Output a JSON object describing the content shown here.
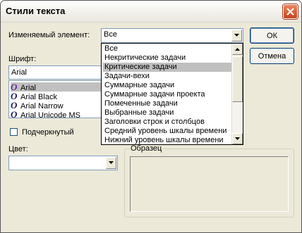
{
  "window": {
    "title": "Стили текста"
  },
  "element_label": "Изменяемый элемент:",
  "element_combo": {
    "value": "Все"
  },
  "buttons": {
    "ok": "ОК",
    "cancel": "Отмена"
  },
  "font_label": "Шрифт:",
  "font_input": {
    "value": "Arial"
  },
  "font_list": [
    "Arial",
    "Arial Black",
    "Arial Narrow",
    "Arial Unicode MS"
  ],
  "font_icon_glyph": "O",
  "underline_label": "Подчеркнутый",
  "color_label": "Цвет:",
  "color_combo": {
    "value": ""
  },
  "sample_label": "Образец",
  "dropdown_items": [
    "Все",
    "Некритические задачи",
    "Критические задачи",
    "Задачи-вехи",
    "Суммарные задачи",
    "Суммарные задачи проекта",
    "Помеченные задачи",
    "Выбранные задачи",
    "Заголовки строк и столбцов",
    "Средний уровень шкалы времени",
    "Нижний уровень шкалы времени"
  ],
  "dropdown_selected": "Критические задачи",
  "font_list_selected": "Arial"
}
